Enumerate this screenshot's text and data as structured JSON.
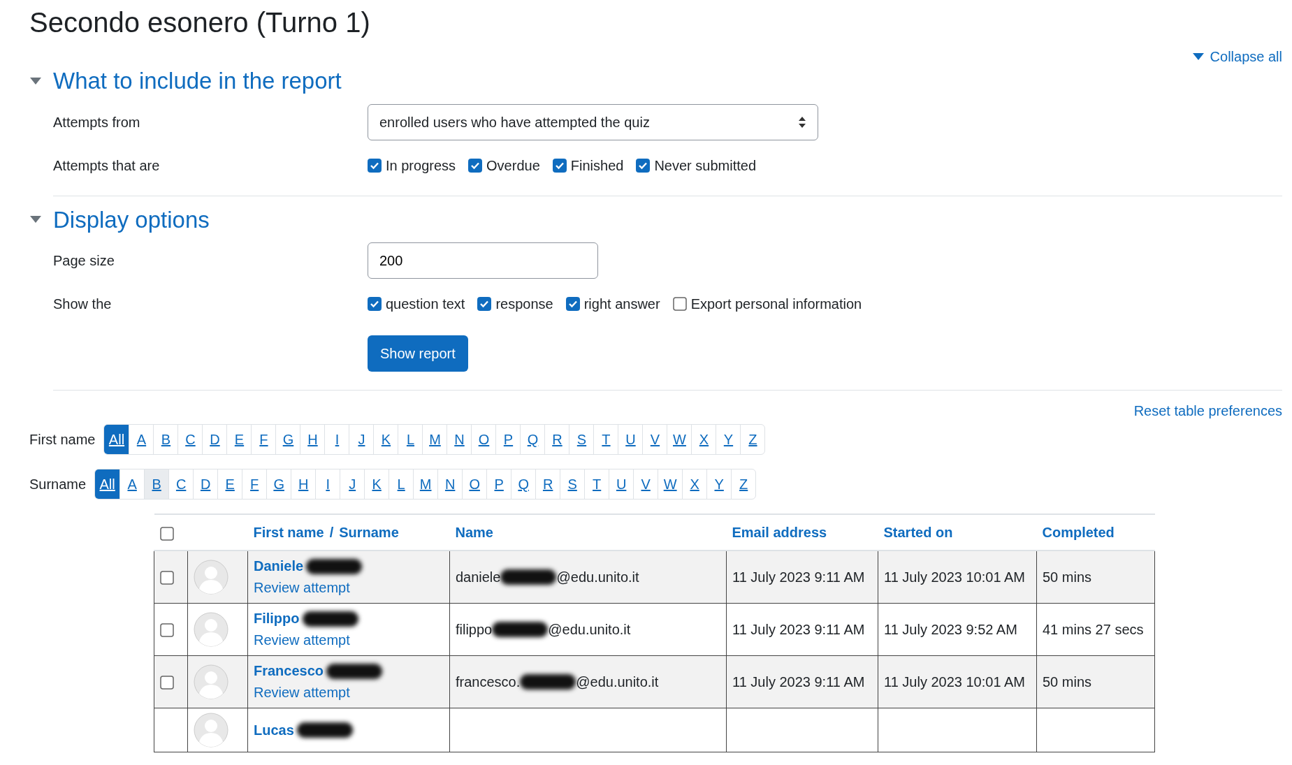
{
  "title": "Secondo esonero (Turno 1)",
  "collapse_all": "Collapse all",
  "sections": [
    {
      "title": "What to include in the report",
      "expanded": true,
      "fields": [
        {
          "kind": "select",
          "label": "Attempts from",
          "value": "enrolled users who have attempted the quiz"
        },
        {
          "kind": "checks",
          "label": "Attempts that are",
          "options": [
            {
              "label": "In progress",
              "checked": true
            },
            {
              "label": "Overdue",
              "checked": true
            },
            {
              "label": "Finished",
              "checked": true
            },
            {
              "label": "Never submitted",
              "checked": true
            }
          ]
        }
      ]
    },
    {
      "title": "Display options",
      "expanded": true,
      "fields": [
        {
          "kind": "text",
          "label": "Page size",
          "value": "200"
        },
        {
          "kind": "checks",
          "label": "Show the",
          "options": [
            {
              "label": "question text",
              "checked": true
            },
            {
              "label": "response",
              "checked": true
            },
            {
              "label": "right answer",
              "checked": true
            },
            {
              "label": "Export personal information",
              "checked": false
            }
          ]
        },
        {
          "kind": "button",
          "label": "Show report"
        }
      ]
    }
  ],
  "reset_link": "Reset table preferences",
  "initials_bars": [
    {
      "label": "First name",
      "letters": [
        {
          "label": "All",
          "selected": true
        },
        {
          "label": "A",
          "selected": false
        },
        {
          "label": "B",
          "selected": false
        },
        {
          "label": "C",
          "selected": false
        },
        {
          "label": "D",
          "selected": false
        },
        {
          "label": "E",
          "selected": false
        },
        {
          "label": "F",
          "selected": false
        },
        {
          "label": "G",
          "selected": false
        },
        {
          "label": "H",
          "selected": false
        },
        {
          "label": "I",
          "selected": false
        },
        {
          "label": "J",
          "selected": false
        },
        {
          "label": "K",
          "selected": false
        },
        {
          "label": "L",
          "selected": false
        },
        {
          "label": "M",
          "selected": false
        },
        {
          "label": "N",
          "selected": false
        },
        {
          "label": "O",
          "selected": false
        },
        {
          "label": "P",
          "selected": false
        },
        {
          "label": "Q",
          "selected": false
        },
        {
          "label": "R",
          "selected": false
        },
        {
          "label": "S",
          "selected": false
        },
        {
          "label": "T",
          "selected": false
        },
        {
          "label": "U",
          "selected": false
        },
        {
          "label": "V",
          "selected": false
        },
        {
          "label": "W",
          "selected": false
        },
        {
          "label": "X",
          "selected": false
        },
        {
          "label": "Y",
          "selected": false
        },
        {
          "label": "Z",
          "selected": false
        }
      ]
    },
    {
      "label": "Surname",
      "letters": [
        {
          "label": "All",
          "selected": true
        },
        {
          "label": "A",
          "selected": false
        },
        {
          "label": "B",
          "selected": false,
          "hover": true
        },
        {
          "label": "C",
          "selected": false
        },
        {
          "label": "D",
          "selected": false
        },
        {
          "label": "E",
          "selected": false
        },
        {
          "label": "F",
          "selected": false
        },
        {
          "label": "G",
          "selected": false
        },
        {
          "label": "H",
          "selected": false
        },
        {
          "label": "I",
          "selected": false
        },
        {
          "label": "J",
          "selected": false
        },
        {
          "label": "K",
          "selected": false
        },
        {
          "label": "L",
          "selected": false
        },
        {
          "label": "M",
          "selected": false
        },
        {
          "label": "N",
          "selected": false
        },
        {
          "label": "O",
          "selected": false
        },
        {
          "label": "P",
          "selected": false
        },
        {
          "label": "Q",
          "selected": false
        },
        {
          "label": "R",
          "selected": false
        },
        {
          "label": "S",
          "selected": false
        },
        {
          "label": "T",
          "selected": false
        },
        {
          "label": "U",
          "selected": false
        },
        {
          "label": "V",
          "selected": false
        },
        {
          "label": "W",
          "selected": false
        },
        {
          "label": "X",
          "selected": false
        },
        {
          "label": "Y",
          "selected": false
        },
        {
          "label": "Z",
          "selected": false
        }
      ]
    }
  ],
  "table": {
    "select_all_checked": false,
    "columns": {
      "first_name": "First name",
      "separator": "/",
      "surname": "Surname",
      "name": "Name",
      "email": "Email address",
      "started": "Started on",
      "completed": "Completed"
    },
    "rows": [
      {
        "checked": false,
        "first_name": "Daniele",
        "review": "Review attempt",
        "email_start": "daniele",
        "email_end": "@edu.unito.it",
        "started": "11 July 2023 9:11 AM",
        "completed": "11 July 2023 10:01 AM",
        "duration": "50 mins"
      },
      {
        "checked": false,
        "first_name": "Filippo",
        "review": "Review attempt",
        "email_start": "filippo",
        "email_end": "@edu.unito.it",
        "started": "11 July 2023 9:11 AM",
        "completed": "11 July 2023 9:52 AM",
        "duration": "41 mins 27 secs"
      },
      {
        "checked": false,
        "first_name": "Francesco",
        "review": "Review attempt",
        "email_start": "francesco.",
        "email_end": "@edu.unito.it",
        "started": "11 July 2023 9:11 AM",
        "completed": "11 July 2023 10:01 AM",
        "duration": "50 mins"
      },
      {
        "first_name": "Lucas"
      }
    ]
  }
}
